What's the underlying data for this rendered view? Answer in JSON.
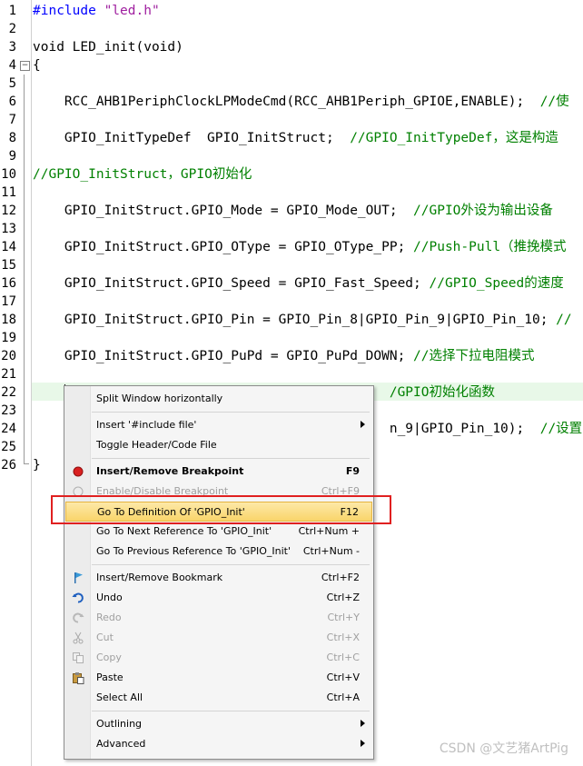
{
  "editor": {
    "lines": [
      {
        "n": "1",
        "parts": [
          {
            "t": "#include ",
            "c": "kw-pre"
          },
          {
            "t": "\"led.h\"",
            "c": "str"
          }
        ]
      },
      {
        "n": "2",
        "parts": []
      },
      {
        "n": "3",
        "parts": [
          {
            "t": "void LED_init(void)",
            "c": ""
          }
        ]
      },
      {
        "n": "4",
        "parts": [
          {
            "t": "{",
            "c": ""
          }
        ]
      },
      {
        "n": "5",
        "parts": []
      },
      {
        "n": "6",
        "parts": [
          {
            "t": "    RCC_AHB1PeriphClockLPModeCmd(RCC_AHB1Periph_GPIOE,ENABLE);  ",
            "c": ""
          },
          {
            "t": "//使",
            "c": "cm"
          }
        ]
      },
      {
        "n": "7",
        "parts": []
      },
      {
        "n": "8",
        "parts": [
          {
            "t": "    GPIO_InitTypeDef  GPIO_InitStruct;  ",
            "c": ""
          },
          {
            "t": "//GPIO_InitTypeDef，这是构造",
            "c": "cm"
          }
        ]
      },
      {
        "n": "9",
        "parts": []
      },
      {
        "n": "10",
        "parts": [
          {
            "t": "//GPIO_InitStruct，GPIO初始化",
            "c": "cm"
          }
        ]
      },
      {
        "n": "11",
        "parts": []
      },
      {
        "n": "12",
        "parts": [
          {
            "t": "    GPIO_InitStruct.GPIO_Mode = GPIO_Mode_OUT;  ",
            "c": ""
          },
          {
            "t": "//GPIO外设为输出设备",
            "c": "cm"
          }
        ]
      },
      {
        "n": "13",
        "parts": []
      },
      {
        "n": "14",
        "parts": [
          {
            "t": "    GPIO_InitStruct.GPIO_OType = GPIO_OType_PP; ",
            "c": ""
          },
          {
            "t": "//Push-Pull（推挽模式",
            "c": "cm"
          }
        ]
      },
      {
        "n": "15",
        "parts": []
      },
      {
        "n": "16",
        "parts": [
          {
            "t": "    GPIO_InitStruct.GPIO_Speed = GPIO_Fast_Speed; ",
            "c": ""
          },
          {
            "t": "//GPIO_Speed的速度",
            "c": "cm"
          }
        ]
      },
      {
        "n": "17",
        "parts": []
      },
      {
        "n": "18",
        "parts": [
          {
            "t": "    GPIO_InitStruct.GPIO_Pin = GPIO_Pin_8|GPIO_Pin_9|GPIO_Pin_10; ",
            "c": ""
          },
          {
            "t": "//",
            "c": "cm"
          }
        ]
      },
      {
        "n": "19",
        "parts": []
      },
      {
        "n": "20",
        "parts": [
          {
            "t": "    GPIO_InitStruct.GPIO_PuPd = GPIO_PuPd_DOWN; ",
            "c": ""
          },
          {
            "t": "//选择下拉电阻模式",
            "c": "cm"
          }
        ]
      },
      {
        "n": "21",
        "parts": []
      },
      {
        "n": "22",
        "parts": [
          {
            "t": "                                             ",
            "c": ""
          },
          {
            "t": "/GPIO初始化函数",
            "c": "cm"
          }
        ]
      },
      {
        "n": "23",
        "parts": []
      },
      {
        "n": "24",
        "parts": [
          {
            "t": "                                             ",
            "c": ""
          },
          {
            "t": "n_9|GPIO_Pin_10);  ",
            "c": ""
          },
          {
            "t": "//设置引",
            "c": "cm"
          }
        ]
      },
      {
        "n": "25",
        "parts": []
      },
      {
        "n": "26",
        "parts": [
          {
            "t": "}",
            "c": ""
          }
        ]
      }
    ]
  },
  "context_menu": {
    "items": [
      {
        "type": "item",
        "label": "Split Window horizontally",
        "shortcut": "",
        "icon": "",
        "disabled": false,
        "bold": false,
        "submenu": false
      },
      {
        "type": "sep"
      },
      {
        "type": "item",
        "label": "Insert '#include file'",
        "shortcut": "",
        "icon": "",
        "disabled": false,
        "bold": false,
        "submenu": true
      },
      {
        "type": "item",
        "label": "Toggle Header/Code File",
        "shortcut": "",
        "icon": "",
        "disabled": false,
        "bold": false,
        "submenu": false
      },
      {
        "type": "sep"
      },
      {
        "type": "item",
        "label": "Insert/Remove Breakpoint",
        "shortcut": "F9",
        "icon": "breakpoint-icon",
        "disabled": false,
        "bold": true,
        "submenu": false
      },
      {
        "type": "item",
        "label": "Enable/Disable Breakpoint",
        "shortcut": "Ctrl+F9",
        "icon": "breakpoint-disabled-icon",
        "disabled": true,
        "bold": false,
        "submenu": false
      },
      {
        "type": "item",
        "label": "Go To Definition Of 'GPIO_Init'",
        "shortcut": "F12",
        "icon": "",
        "disabled": false,
        "bold": false,
        "submenu": false,
        "selected": true
      },
      {
        "type": "item",
        "label": "Go To Next Reference To 'GPIO_Init'",
        "shortcut": "Ctrl+Num +",
        "icon": "",
        "disabled": false,
        "bold": false,
        "submenu": false
      },
      {
        "type": "item",
        "label": "Go To Previous Reference To 'GPIO_Init'",
        "shortcut": "Ctrl+Num -",
        "icon": "",
        "disabled": false,
        "bold": false,
        "submenu": false
      },
      {
        "type": "sep"
      },
      {
        "type": "item",
        "label": "Insert/Remove Bookmark",
        "shortcut": "Ctrl+F2",
        "icon": "bookmark-flag-icon",
        "disabled": false,
        "bold": false,
        "submenu": false
      },
      {
        "type": "item",
        "label": "Undo",
        "shortcut": "Ctrl+Z",
        "icon": "undo-icon",
        "disabled": false,
        "bold": false,
        "submenu": false
      },
      {
        "type": "item",
        "label": "Redo",
        "shortcut": "Ctrl+Y",
        "icon": "redo-icon",
        "disabled": true,
        "bold": false,
        "submenu": false
      },
      {
        "type": "item",
        "label": "Cut",
        "shortcut": "Ctrl+X",
        "icon": "cut-icon",
        "disabled": true,
        "bold": false,
        "submenu": false
      },
      {
        "type": "item",
        "label": "Copy",
        "shortcut": "Ctrl+C",
        "icon": "copy-icon",
        "disabled": true,
        "bold": false,
        "submenu": false
      },
      {
        "type": "item",
        "label": "Paste",
        "shortcut": "Ctrl+V",
        "icon": "paste-icon",
        "disabled": false,
        "bold": false,
        "submenu": false
      },
      {
        "type": "item",
        "label": "Select All",
        "shortcut": "Ctrl+A",
        "icon": "",
        "disabled": false,
        "bold": false,
        "submenu": false
      },
      {
        "type": "sep"
      },
      {
        "type": "item",
        "label": "Outlining",
        "shortcut": "",
        "icon": "",
        "disabled": false,
        "bold": false,
        "submenu": true
      },
      {
        "type": "item",
        "label": "Advanced",
        "shortcut": "",
        "icon": "",
        "disabled": false,
        "bold": false,
        "submenu": true
      }
    ]
  },
  "watermark": "CSDN @文艺猪ArtPig",
  "colors": {
    "highlight_box": "#e02020",
    "comment": "#008000",
    "preprocessor": "#0000ff",
    "string": "#a020a0"
  }
}
